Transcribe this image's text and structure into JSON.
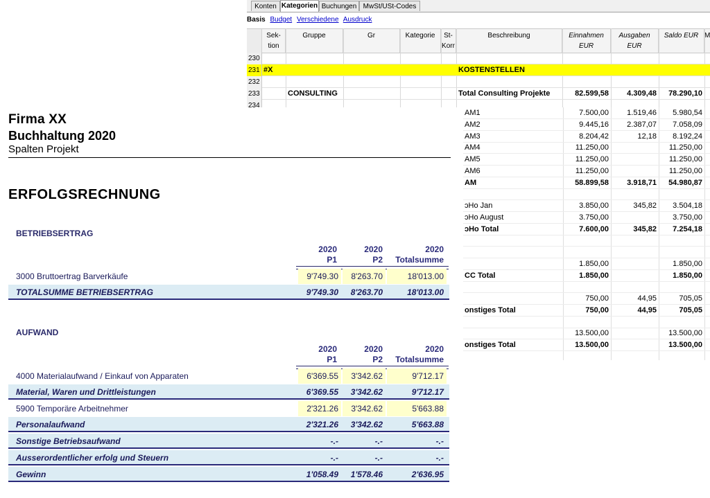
{
  "sheet": {
    "tabs": [
      "Konten",
      "Kategorien",
      "Buchungen",
      "MwSt/USt-Codes"
    ],
    "active_tab": "Kategorien",
    "subtabs": {
      "active": "Basis",
      "links": [
        "Budget",
        "Verschiedene",
        "Ausdruck"
      ]
    },
    "columns": [
      {
        "label": "Sek-\ntion"
      },
      {
        "label": "Gruppe"
      },
      {
        "label": "Gr"
      },
      {
        "label": "Kategorie"
      },
      {
        "label": "St-\nKorr"
      },
      {
        "label": "Beschreibung"
      },
      {
        "label": "Einnahmen\nEUR"
      },
      {
        "label": "Ausgaben EUR"
      },
      {
        "label": "Saldo EUR"
      },
      {
        "label": "M"
      }
    ],
    "rows": [
      {
        "num": "230",
        "sektion": "",
        "gruppe": "",
        "beschreibung": "",
        "einnahmen": "",
        "ausgaben": "",
        "saldo": ""
      },
      {
        "num": "231",
        "sektion": "#X",
        "gruppe": "",
        "beschreibung": "KOSTENSTELLEN",
        "einnahmen": "",
        "ausgaben": "",
        "saldo": ""
      },
      {
        "num": "232",
        "sektion": "",
        "gruppe": "",
        "beschreibung": "",
        "einnahmen": "",
        "ausgaben": "",
        "saldo": ""
      },
      {
        "num": "233",
        "sektion": "",
        "gruppe": "CONSULTING",
        "beschreibung": "Total Consulting Projekte",
        "einnahmen": "82.599,58",
        "ausgaben": "4.309,48",
        "saldo": "78.290,10"
      },
      {
        "num": "234",
        "sektion": "",
        "gruppe": "",
        "beschreibung": "",
        "einnahmen": "",
        "ausgaben": "",
        "saldo": ""
      }
    ],
    "highlight_color": "#ffff00"
  },
  "fragment": {
    "rows": [
      {
        "label": "AM1",
        "einnahmen": "7.500,00",
        "ausgaben": "1.519,46",
        "saldo": "5.980,54",
        "bold": false
      },
      {
        "label": "AM2",
        "einnahmen": "9.445,16",
        "ausgaben": "2.387,07",
        "saldo": "7.058,09",
        "bold": false
      },
      {
        "label": "AM3",
        "einnahmen": "8.204,42",
        "ausgaben": "12,18",
        "saldo": "8.192,24",
        "bold": false
      },
      {
        "label": "AM4",
        "einnahmen": "11.250,00",
        "ausgaben": "",
        "saldo": "11.250,00",
        "bold": false
      },
      {
        "label": "AM5",
        "einnahmen": "11.250,00",
        "ausgaben": "",
        "saldo": "11.250,00",
        "bold": false
      },
      {
        "label": "AM6",
        "einnahmen": "11.250,00",
        "ausgaben": "",
        "saldo": "11.250,00",
        "bold": false
      },
      {
        "label": "AM",
        "einnahmen": "58.899,58",
        "ausgaben": "3.918,71",
        "saldo": "54.980,87",
        "bold": true
      },
      {
        "label": "",
        "einnahmen": "",
        "ausgaben": "",
        "saldo": "",
        "bold": false
      },
      {
        "label": "ɔHo Jan",
        "einnahmen": "3.850,00",
        "ausgaben": "345,82",
        "saldo": "3.504,18",
        "bold": false
      },
      {
        "label": "ɔHo August",
        "einnahmen": "3.750,00",
        "ausgaben": "",
        "saldo": "3.750,00",
        "bold": false
      },
      {
        "label": "ɔHo Total",
        "einnahmen": "7.600,00",
        "ausgaben": "345,82",
        "saldo": "7.254,18",
        "bold": true
      },
      {
        "label": "",
        "einnahmen": "",
        "ausgaben": "",
        "saldo": "",
        "bold": false
      },
      {
        "label": "",
        "einnahmen": "",
        "ausgaben": "",
        "saldo": "",
        "bold": false
      },
      {
        "label": "",
        "einnahmen": "1.850,00",
        "ausgaben": "",
        "saldo": "1.850,00",
        "bold": false
      },
      {
        "label": "CC Total",
        "einnahmen": "1.850,00",
        "ausgaben": "",
        "saldo": "1.850,00",
        "bold": true
      },
      {
        "label": "",
        "einnahmen": "",
        "ausgaben": "",
        "saldo": "",
        "bold": false
      },
      {
        "label": "",
        "einnahmen": "750,00",
        "ausgaben": "44,95",
        "saldo": "705,05",
        "bold": false
      },
      {
        "label": "onstiges Total",
        "einnahmen": "750,00",
        "ausgaben": "44,95",
        "saldo": "705,05",
        "bold": true
      },
      {
        "label": "",
        "einnahmen": "",
        "ausgaben": "",
        "saldo": "",
        "bold": false
      },
      {
        "label": "",
        "einnahmen": "13.500,00",
        "ausgaben": "",
        "saldo": "13.500,00",
        "bold": false
      },
      {
        "label": "onstiges Total",
        "einnahmen": "13.500,00",
        "ausgaben": "",
        "saldo": "13.500,00",
        "bold": true
      }
    ]
  },
  "report": {
    "company": "Firma XX",
    "book": "Buchhaltung 2020",
    "subtitle": "Spalten Projekt",
    "heading": "ERFOLGSRECHNUNG",
    "col_year": "2020",
    "col_p1": "P1",
    "col_p2": "P2",
    "col_total": "Totalsumme",
    "sections": {
      "betriebsertrag": {
        "title": "BETRIEBSERTRAG",
        "rows": [
          {
            "label": "3000   Bruttoertrag Barverkäufe",
            "p1": "9'749.30",
            "p2": "8'263.70",
            "total": "18'013.00",
            "type": "detail"
          },
          {
            "label": "TOTALSUMME BETRIEBSERTRAG",
            "p1": "9'749.30",
            "p2": "8'263.70",
            "total": "18'013.00",
            "type": "total"
          }
        ]
      },
      "aufwand": {
        "title": "AUFWAND",
        "rows": [
          {
            "label": "4000   Materialaufwand / Einkauf von Apparaten",
            "p1": "6'369.55",
            "p2": "3'342.62",
            "total": "9'712.17",
            "type": "detail"
          },
          {
            "label": "Material, Waren und Drittleistungen",
            "p1": "6'369.55",
            "p2": "3'342.62",
            "total": "9'712.17",
            "type": "total"
          },
          {
            "label": "5900   Temporäre Arbeitnehmer",
            "p1": "2'321.26",
            "p2": "3'342.62",
            "total": "5'663.88",
            "type": "detail"
          },
          {
            "label": "Personalaufwand",
            "p1": "2'321.26",
            "p2": "3'342.62",
            "total": "5'663.88",
            "type": "total"
          },
          {
            "label": "Sonstige Betriebsaufwand",
            "p1": "-.-",
            "p2": "-.-",
            "total": "-.-",
            "type": "total"
          },
          {
            "label": "Ausserordentlicher erfolg und Steuern",
            "p1": "-.-",
            "p2": "-.-",
            "total": "-.-",
            "type": "total"
          },
          {
            "label": "Gewinn",
            "p1": "1'058.49",
            "p2": "1'578.46",
            "total": "2'636.95",
            "type": "total"
          }
        ]
      }
    }
  }
}
